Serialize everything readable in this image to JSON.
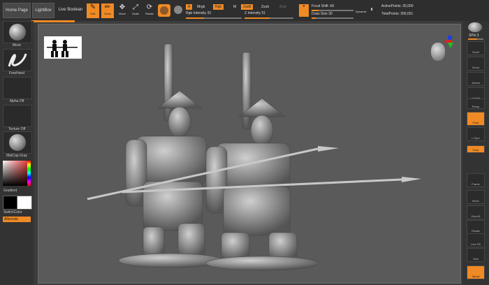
{
  "tabs": {
    "home": "Home Page",
    "lightbox": "LightBox",
    "live_boolean": "Live Boolean"
  },
  "tools": {
    "edit": "Edit",
    "draw": "Draw",
    "move": "Move",
    "scale": "Scale",
    "rotate": "Rotate"
  },
  "material_mode": {
    "a": "A",
    "mrgb": "Mrgb",
    "rgb": "Rgb",
    "m": "M",
    "zadd": "Zadd",
    "zsub": "Zsub",
    "zcut": "Zcut"
  },
  "params": {
    "rgb_intensity_label": "Rgb Intensity",
    "rgb_intensity_value": "32",
    "z_intensity_label": "Z Intensity",
    "z_intensity_value": "51",
    "focal_shift_label": "Focal Shift",
    "focal_shift_value": "-66",
    "draw_size_label": "Draw Size",
    "draw_size_value": "30",
    "dynamic": "Dynamic",
    "active_points": "ActivePoints: 35,000",
    "total_points": "TotalPoints: 399,051"
  },
  "left_panel": {
    "brush": "Move",
    "stroke": "FreeHand",
    "alpha": "Alpha Off",
    "texture": "Texture Off",
    "material": "MatCap Gray",
    "gradient": "Gradient",
    "switch_color": "SwitchColor",
    "alternate": "Alternate"
  },
  "right_panel": {
    "spix": "SPix 3",
    "buttons": [
      "Scroll",
      "Zoom",
      "Actual",
      "AAHalf",
      "Persp",
      "Floor",
      "L.Sym",
      "Gxyz",
      "Frame",
      "Move",
      "ZoomD",
      "Rotate",
      "Line Fill",
      "Solo",
      "Xpose"
    ]
  },
  "colors": {
    "accent": "#f08a24",
    "canvas_bg": "#5a5a5a",
    "ui_bg": "#333333"
  }
}
